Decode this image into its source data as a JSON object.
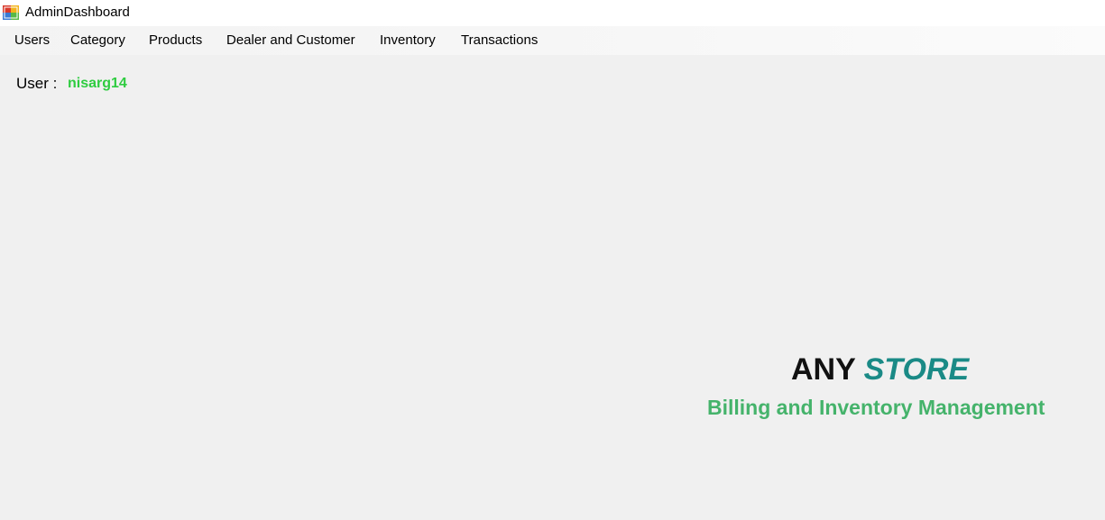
{
  "window": {
    "title": "AdminDashboard",
    "icon": "form-app-icon"
  },
  "menu": {
    "items": [
      {
        "label": "Users"
      },
      {
        "label": "Category"
      },
      {
        "label": "Products"
      },
      {
        "label": "Dealer and Customer"
      },
      {
        "label": "Inventory"
      },
      {
        "label": "Transactions"
      }
    ]
  },
  "user": {
    "label": "User :",
    "name": "nisarg14"
  },
  "branding": {
    "name_part1": "ANY",
    "name_part2": "STORE",
    "tagline": "Billing and Inventory Management"
  },
  "colors": {
    "background": "#f0f0f0",
    "username": "#2ecc40",
    "store_accent": "#1a8a86",
    "tagline": "#45b36b"
  }
}
